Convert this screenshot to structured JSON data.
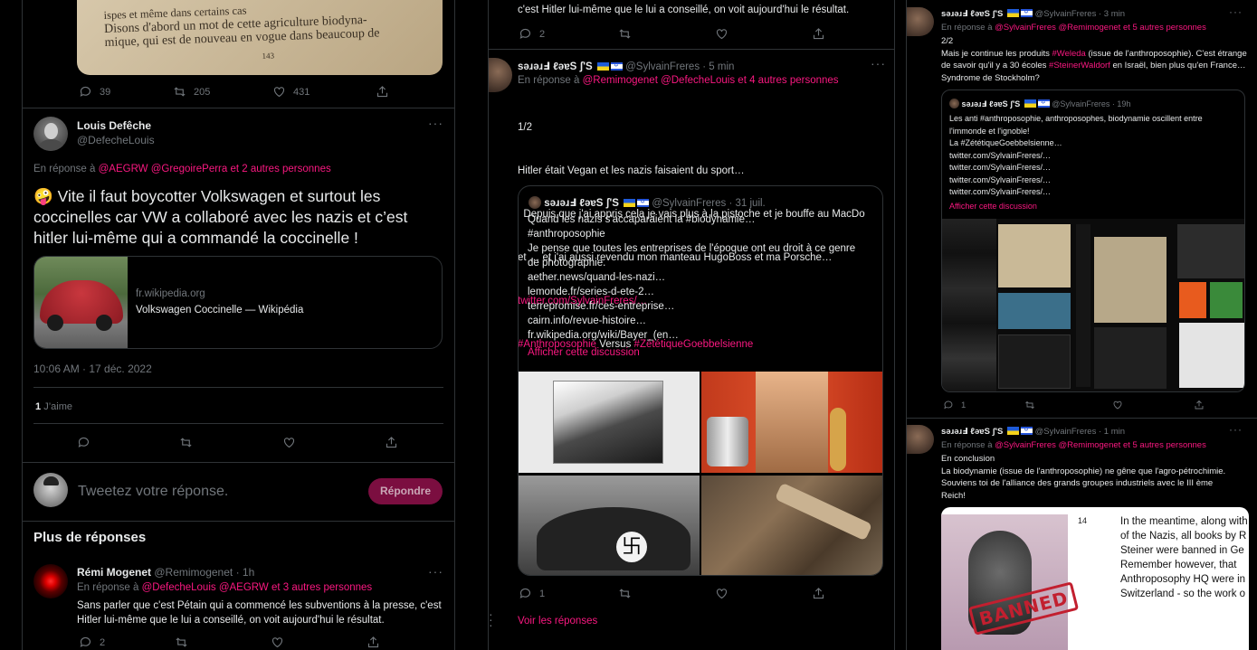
{
  "col1": {
    "top_actions": {
      "replies": "39",
      "retweets": "205",
      "likes": "431"
    },
    "book_page_lines": [
      "ispes et même dans certains cas",
      "Disons d'abord un mot de cette agriculture biodyna-",
      "mique, qui est de nouveau en vogue dans beaucoup de",
      "143"
    ],
    "main_tweet": {
      "name": "Louis Defêche",
      "handle": "@DefecheLouis",
      "reply_prefix": "En réponse à",
      "reply_to": "@AEGRW @GregoirePerra",
      "reply_others": "et 2 autres personnes",
      "text": "🤪 Vite il faut boycotter Volkswagen et surtout les coccinelles car VW a collaboré avec les nazis et c’est hitler lui-même qui a commandé la coccinelle !",
      "card_domain": "fr.wikipedia.org",
      "card_title": "Volkswagen Coccinelle — Wikipédia",
      "timestamp": "10:06 AM · 17 déc. 2022",
      "likes_count": "1",
      "likes_label": "J’aime"
    },
    "reply_box": {
      "placeholder": "Tweetez votre réponse.",
      "button": "Répondre"
    },
    "more_replies": "Plus de réponses",
    "reply1": {
      "name": "Rémi Mogenet",
      "handle": "@Remimogenet · 1h",
      "reply_prefix": "En réponse à",
      "reply_to": "@DefecheLouis @AEGRW",
      "reply_others": "et 3 autres personnes",
      "text": "Sans parler que c'est Pétain qui a commencé les subventions à la presse, c'est Hitler lui-même que le lui a conseillé, on voit aujourd'hui le résultat.",
      "replies": "2"
    }
  },
  "col2": {
    "top_text": "c'est Hitler lui-même que le lui a conseillé, on voit aujourd'hui le résultat.",
    "top_replies": "2",
    "tweet": {
      "name": "sǝɹǝɹℲ ℓǝɐS ʃ'S",
      "handle": "@SylvainFreres · 5 min",
      "reply_prefix": "En réponse à",
      "reply_to": "@Remimogenet @DefecheLouis",
      "reply_others": "et 4 autres personnes",
      "lines": [
        "1/2",
        "Hitler était Vegan et les nazis faisaient du sport…",
        "  Depuis que j'ai appris cela je vais plus à la pistoche et je bouffe au MacDo",
        "et … et j'ai aussi revendu mon manteau HugoBoss et ma Porsche…"
      ],
      "link": "twitter.com/SylvainFreres/…",
      "hashtag1": "#Anthroposophie",
      "versus": "Versus",
      "hashtag2": "#ZététiqueGoebbelsienne",
      "quote": {
        "name": "sǝɹǝɹℲ ℓǝɐS ʃ'S",
        "handle": "@SylvainFreres · 31 juil.",
        "lines": [
          "Quand les nazis s'accaparaient la #biodynamie…",
          "#anthroposophie",
          "Je pense que toutes les entreprises de l'époque ont eu droit à ce genre",
          "de photographie.",
          "aether.news/quand-les-nazi…",
          "lemonde.fr/series-d-ete-2…",
          "terrepromise.fr/ces-entreprise…",
          "cairn.info/revue-histoire…",
          "fr.wikipedia.org/wiki/Bayer_(en…"
        ],
        "show_thread": "Afficher cette discussion"
      },
      "replies": "1",
      "see_replies": "Voir les réponses"
    }
  },
  "col3": {
    "t1": {
      "name": "sǝɹǝɹℲ ℓǝɐS ʃ'S",
      "handle": "@SylvainFreres · 3 min",
      "reply_prefix": "En réponse à",
      "reply_to": "@SylvainFreres @Remimogenet",
      "reply_others": "et 5 autres personnes",
      "counter": "2/2",
      "text_a": "Mais je continue les produits ",
      "tag_a": "#Weleda",
      "text_b": " (issue de l'anthroposophie). C'est étrange de savoir qu'il y a 30 écoles ",
      "tag_b": "#SteinerWaldorf",
      "text_c": " en Israël, bien plus qu'en France… Syndrome de Stockholm?",
      "quote": {
        "name": "sǝɹǝɹℲ ℓǝɐS ʃ'S",
        "handle": "@SylvainFreres · 19h",
        "lines": [
          "Les anti #anthroposophie, anthroposophes, biodynamie oscillent entre",
          "l'immonde et l'ignoble!",
          "La #ZététiqueGoebbelsienne…",
          "twitter.com/SylvainFreres/…",
          "twitter.com/SylvainFreres/…",
          "twitter.com/SylvainFreres/…",
          "twitter.com/SylvainFreres/…"
        ],
        "show_thread": "Afficher cette discussion"
      },
      "replies": "1"
    },
    "t2": {
      "name": "sǝɹǝɹℲ ℓǝɐS ʃ'S",
      "handle": "@SylvainFreres · 1 min",
      "reply_prefix": "En réponse à",
      "reply_to": "@SylvainFreres @Remimogenet",
      "reply_others": "et 5 autres personnes",
      "lines": [
        "En conclusion",
        "La biodynamie (issue de l'anthroposophie) ne gêne que l'agro-pétrochimie.",
        "Souviens toi de l'alliance des grands groupes industriels avec le III ème",
        "Reich!"
      ],
      "page_number": "14",
      "book_lines": [
        "In the meantime, along with",
        "of the Nazis, all books by R",
        "Steiner were banned in Ge",
        "Remember however, that",
        "Anthroposophy HQ were in",
        "Switzerland - so the work o"
      ],
      "stamp": "BANNED"
    }
  },
  "colors": {
    "accent": "#f91880",
    "muted": "#71767b",
    "border": "#2f3336",
    "bg": "#000000"
  }
}
